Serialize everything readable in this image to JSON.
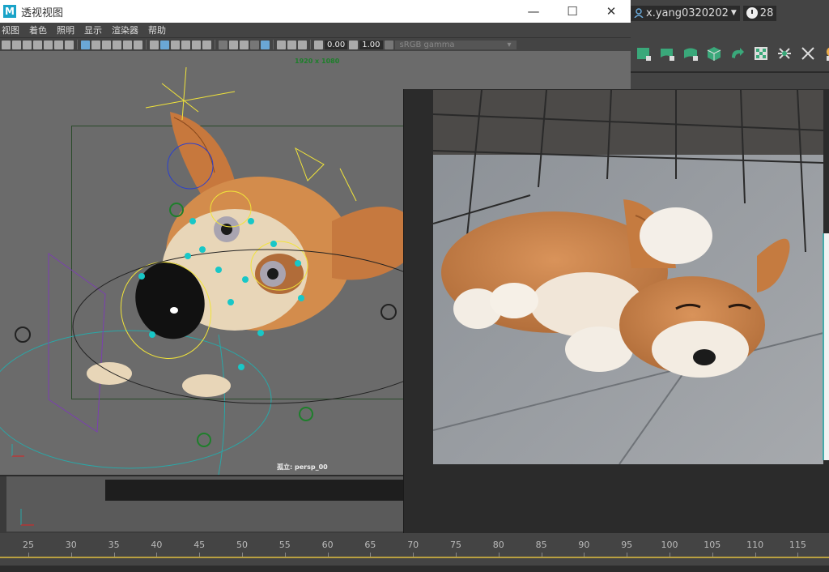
{
  "window": {
    "title": "透视视图",
    "app_icon": "M",
    "controls": {
      "minimize": "—",
      "maximize": "☐",
      "close": "✕"
    }
  },
  "menu": [
    "视图",
    "着色",
    "照明",
    "显示",
    "渲染器",
    "帮助"
  ],
  "toolbar": {
    "value1": "0.00",
    "value2": "1.00",
    "color_space": "sRGB gamma"
  },
  "viewport": {
    "resolution": "1920 x 1080",
    "camera": "孤立: persp_00"
  },
  "user": {
    "name": "x.yang0320202",
    "count": "28"
  },
  "timeline": {
    "ticks": [
      "25",
      "30",
      "35",
      "40",
      "45",
      "50",
      "55",
      "60",
      "65",
      "70",
      "75",
      "80",
      "85",
      "90",
      "95",
      "100",
      "105",
      "110",
      "115"
    ]
  },
  "colors": {
    "accent_line": "#b9a040",
    "shelf_green": "#3aa87a",
    "rig_yellow": "#f1e43a",
    "rig_cyan": "#18c7c7"
  }
}
